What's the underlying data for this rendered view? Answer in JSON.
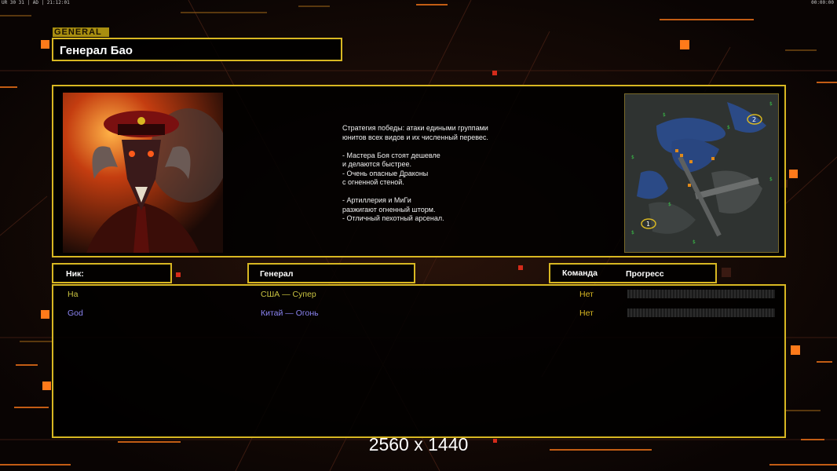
{
  "topbar": {
    "left": "UR 30 31 | AD | 21:12:01",
    "right": "00:00:00"
  },
  "general_tag": "GENERAL",
  "general_name": "Генерал Бао",
  "description": "Стратегия победы: атаки едиными группами\nюнитов всех видов и их численный перевес.\n\n- Мастера Боя стоят дешевле\nи делаются быстрее.\n- Очень опасные Драконы\nс огненной стеной.\n\n- Артиллерия и МиГи\nразжигают огненный шторм.\n- Отличный пехотный арсенал.",
  "minimap": {
    "start_1": "1",
    "start_2": "2"
  },
  "headers": {
    "nick": "Ник:",
    "general": "Генерал",
    "team": "Команда",
    "progress": "Прогресс"
  },
  "players": [
    {
      "nick": "Ha",
      "general": "США — Супер",
      "team": "Нет",
      "color": "#c9c341",
      "progress": 0
    },
    {
      "nick": "God",
      "general": "Китай — Огонь",
      "team": "Нет",
      "color": "#8b84f2",
      "progress": 0
    }
  ],
  "resolution_label": "2560 x 1440",
  "colors": {
    "gold": "#d8b722",
    "accent_orange": "#ff7a1a"
  }
}
